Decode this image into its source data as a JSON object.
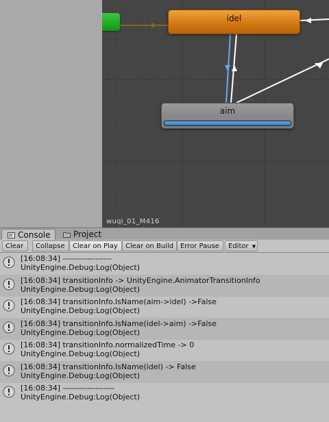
{
  "graph": {
    "layer_name": "wuqi_01_M416",
    "nodes": {
      "idel_label": "idel",
      "aim_label": "aim",
      "aim_progress": 1.0
    },
    "colors": {
      "entry": "#1aa01a",
      "default_state": "#d87e14",
      "state": "#888888",
      "active_transition": "#6aa8ec",
      "transition": "#ffffff",
      "entry_transition": "#8a6414"
    }
  },
  "tabs": [
    {
      "label": "Console",
      "icon": "console-icon",
      "active": true
    },
    {
      "label": "Project",
      "icon": "folder-icon",
      "active": false
    }
  ],
  "toolbar": {
    "clear": "Clear",
    "collapse": "Collapse",
    "clear_on_play": "Clear on Play",
    "clear_on_build": "Clear on Build",
    "error_pause": "Error Pause",
    "editor": "Editor"
  },
  "log": {
    "entries": [
      {
        "line1": "[16:08:34] ------------------",
        "line2": "UnityEngine.Debug:Log(Object)",
        "icon": "info-icon"
      },
      {
        "line1": "[16:08:34] transitionInfo -> UnityEngine.AnimatorTransitionInfo",
        "line2": "UnityEngine.Debug:Log(Object)",
        "icon": "info-icon"
      },
      {
        "line1": "[16:08:34] transitionInfo.IsName(aim->idel) ->False",
        "line2": "UnityEngine.Debug:Log(Object)",
        "icon": "info-icon"
      },
      {
        "line1": "[16:08:34] transitionInfo.IsName(idel->aim) ->False",
        "line2": "UnityEngine.Debug:Log(Object)",
        "icon": "info-icon"
      },
      {
        "line1": "[16:08:34] transitionInfo.normalizedTime -> 0",
        "line2": "UnityEngine.Debug:Log(Object)",
        "icon": "info-icon"
      },
      {
        "line1": "[16:08:34] transitionInfo.IsName(idel) -> False",
        "line2": "UnityEngine.Debug:Log(Object)",
        "icon": "info-icon"
      },
      {
        "line1": "[16:08:34] -------------------",
        "line2": "UnityEngine.Debug:Log(Object)",
        "icon": "info-icon"
      }
    ]
  }
}
